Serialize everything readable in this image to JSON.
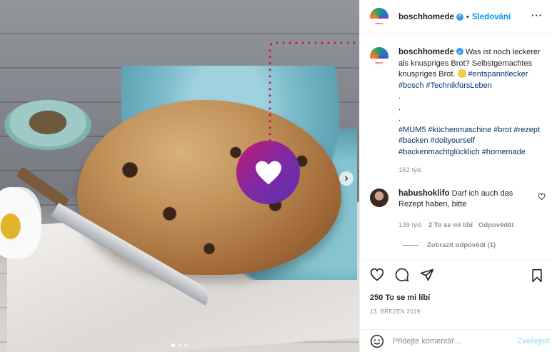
{
  "post": {
    "username": "boschhomede",
    "avatar_text": "BOSCH",
    "follow_label": "Sledování",
    "dot": "•",
    "more_label": "···"
  },
  "caption": {
    "username": "boschhomede",
    "text_before": "Was ist noch leckerer als knuspriges Brot? Selbstgemachtes knuspriges Brot.",
    "tag_first": "#entspanntlecker",
    "line_2": "#bosch #TechnikfürsLeben",
    "dots_1": ".",
    "dots_2": ".",
    "dots_3": ".",
    "line_3": "#MUM5 #küchenmaschine #brot #rezept #backen #doityourself #backenmachtglücklich #homemade",
    "time": "162 týd."
  },
  "comment": {
    "username": "habushoklifo",
    "text": "Darf ich auch das Rezept haben, bitte",
    "time": "139 týd.",
    "likes": "2 To se mi líbí",
    "reply_label": "Odpovědět",
    "view_replies": "Zobrazit odpovědi (1)"
  },
  "stats": {
    "likes": "250 To se mi líbí",
    "date": "13. BŘEZEN 2019"
  },
  "composer": {
    "placeholder": "Přidejte komentář...",
    "post_label": "Zveřejnit"
  },
  "carousel": {
    "pages": 3,
    "active_page": 1
  },
  "colors": {
    "link_blue": "#0095f6",
    "tag_blue": "#00376b",
    "muted": "#8e8e8e",
    "heart_gradient_start": "#c01a6e",
    "heart_gradient_end": "#5b2fa8"
  }
}
